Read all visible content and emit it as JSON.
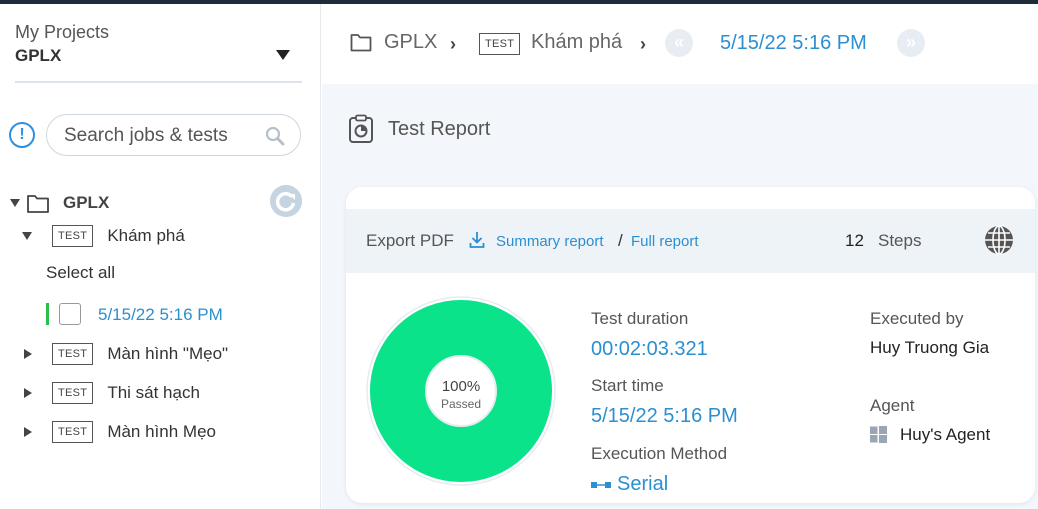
{
  "sidebar": {
    "project_label": "My Projects",
    "project_name": "GPLX",
    "search_placeholder": "Search jobs & tests",
    "tree": {
      "root_label": "GPLX",
      "test_tag": "TEST",
      "tests": [
        {
          "label": "Khám phá",
          "expanded": true
        },
        {
          "label": "Màn hình \"Mẹo\"",
          "expanded": false
        },
        {
          "label": "Thi sát hạch",
          "expanded": false
        },
        {
          "label": "Màn hình Mẹo",
          "expanded": false
        }
      ],
      "select_all": "Select all",
      "run_label": "5/15/22 5:16 PM"
    }
  },
  "breadcrumb": {
    "folder": "GPLX",
    "tag": "TEST",
    "test": "Khám phá",
    "run": "5/15/22 5:16 PM"
  },
  "report": {
    "title": "Test Report",
    "export_pdf": "Export PDF",
    "summary_link": "Summary report",
    "separator": "/",
    "full_link": "Full report",
    "steps_count": "12",
    "steps_label": "Steps",
    "donut": {
      "percent": "100%",
      "status": "Passed",
      "passed_fraction": 1.0,
      "color": "#0be38a"
    },
    "duration_label": "Test duration",
    "duration_value": "00:02:03.321",
    "start_label": "Start time",
    "start_value": "5/15/22 5:16 PM",
    "method_label": "Execution Method",
    "method_value": "Serial",
    "executed_label": "Executed by",
    "executed_value": "Huy Truong Gia",
    "agent_label": "Agent",
    "agent_value": "Huy's Agent"
  },
  "colors": {
    "accent": "#2b8fd0",
    "passed": "#0be38a",
    "selected_marker": "#27c04d"
  }
}
